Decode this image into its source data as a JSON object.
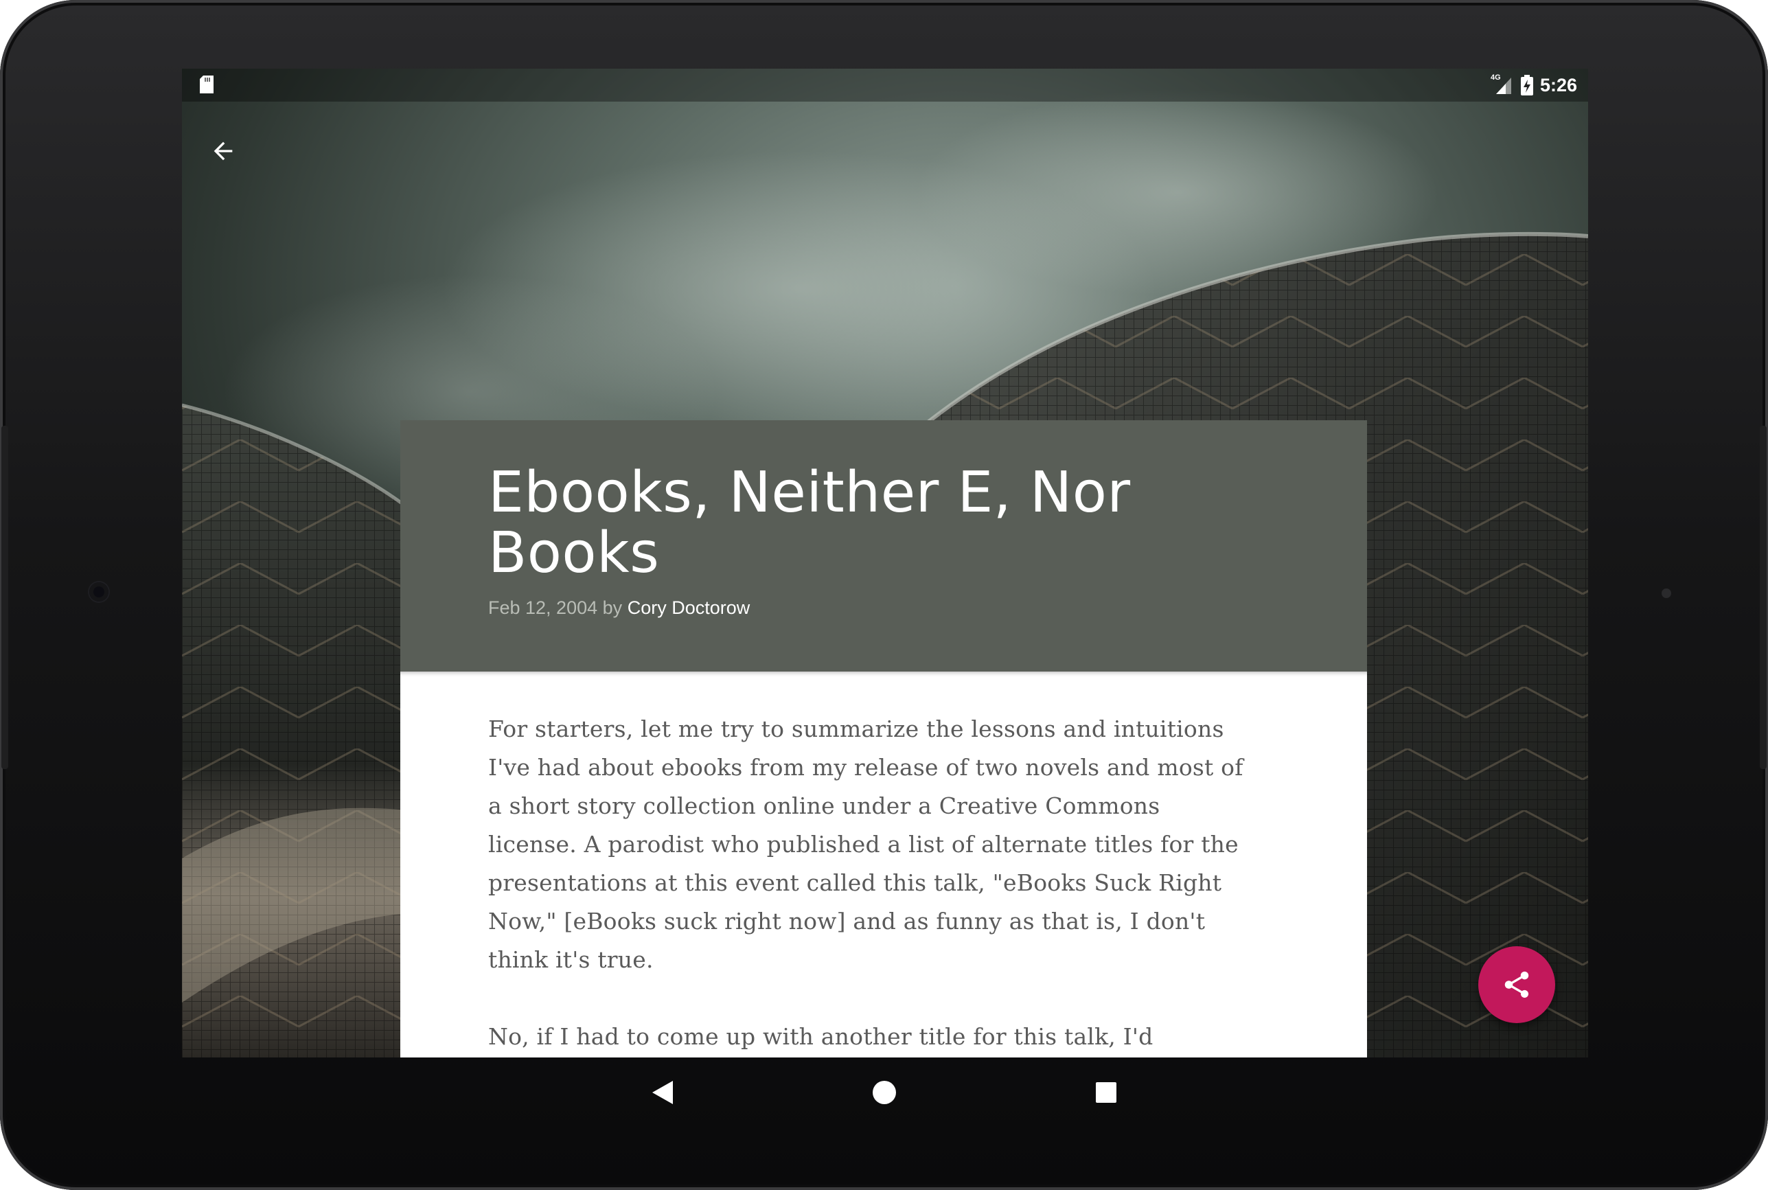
{
  "status_bar": {
    "time": "5:26",
    "network_label": "4G",
    "icons": [
      "sd-card-icon",
      "cell-signal-icon",
      "battery-charging-icon"
    ]
  },
  "toolbar": {
    "back_icon": "arrow-back-icon"
  },
  "article": {
    "title": "Ebooks, Neither E, Nor Books",
    "date": "Feb 12, 2004",
    "by_word": "by",
    "author": "Cory Doctorow",
    "paragraphs": [
      "For starters, let me try to summarize the lessons and intuitions I've had about ebooks from my release of two novels and most of a short story collection online under a Creative Commons license. A parodist who published a list of alternate titles for the presentations at this event called this talk, \"eBooks Suck Right Now,\" [eBooks suck right now] and as funny as that is, I don't think it's true.",
      "No, if I had to come up with another title for this talk, I'd"
    ]
  },
  "fab": {
    "icon": "share-icon"
  },
  "nav_bar": {
    "icons": [
      "nav-back-icon",
      "nav-home-icon",
      "nav-recents-icon"
    ]
  },
  "colors": {
    "header_bg": "#595e57",
    "fab_bg": "#c2185b",
    "body_text": "#5a5a5a",
    "byline_date": "#b9bdb6"
  }
}
